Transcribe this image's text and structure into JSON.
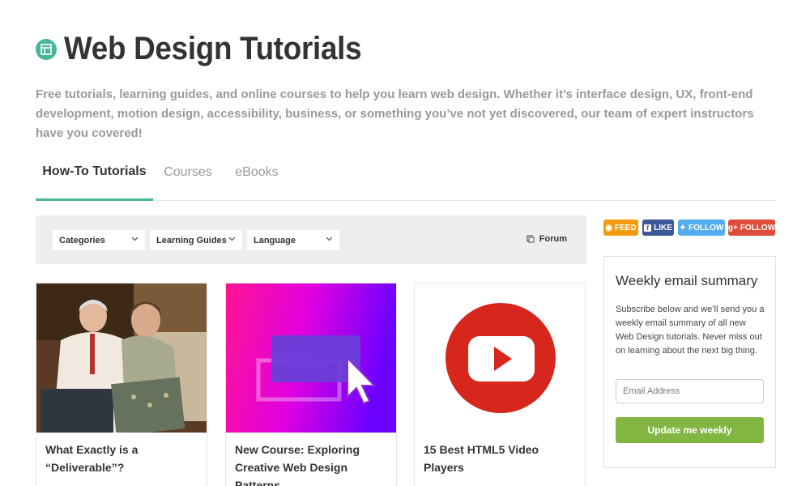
{
  "header": {
    "title": "Web Design Tutorials",
    "description": "Free tutorials, learning guides, and online courses to help you learn web design. Whether it’s interface design, UX, front-end development, motion design, accessibility, business, or something you’ve not yet discovered, our team of expert instructors have you covered!",
    "accent_color": "#49b59a"
  },
  "tabs": [
    {
      "label": "How-To Tutorials",
      "active": true
    },
    {
      "label": "Courses",
      "active": false
    },
    {
      "label": "eBooks",
      "active": false
    }
  ],
  "filters": {
    "categories": "Categories",
    "learning_guides": "Learning Guides",
    "language": "Language",
    "forum": "Forum"
  },
  "cards": [
    {
      "title": "What Exactly is a “Deliverable”?",
      "thumb": "vintage-photo"
    },
    {
      "title": "New Course: Exploring Creative Web Design Patterns",
      "thumb": "gradient-cursor"
    },
    {
      "title": "15 Best HTML5 Video Players",
      "thumb": "youtube-play"
    }
  ],
  "social": {
    "feed": "FEED",
    "like": "LIKE",
    "twitter": "FOLLOW",
    "google": "FOLLOW",
    "colors": {
      "feed": "#f39c12",
      "like": "#3b5998",
      "twitter": "#55acee",
      "google": "#dd4b39"
    }
  },
  "sidebar": {
    "heading": "Weekly email summary",
    "text": "Subscribe below and we’ll send you a weekly email summary of all new Web Design tutorials. Never miss out on learning about the next big thing.",
    "email_placeholder": "Email Address",
    "button": "Update me weekly"
  }
}
